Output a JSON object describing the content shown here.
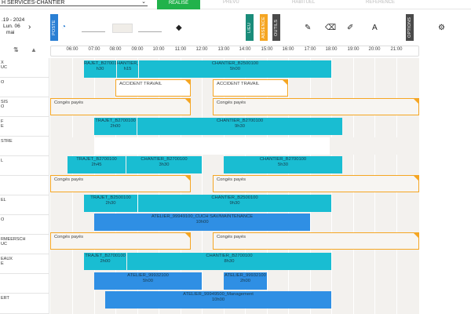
{
  "nav": {
    "filter_select": "H SERVICES-CHANTIER",
    "active_tab": "RÉALISÉ",
    "tabs": [
      "PRÉVU",
      "HABITUEL",
      "RÉFÉRENCE"
    ]
  },
  "toolbar": {
    "date_line1": ".19 - 2024",
    "date_line2": "Lun. 06",
    "date_line3": "mai",
    "vtab_poste": "POSTE",
    "vtab_lieu": "LIEU",
    "vtab_absence": "ABSENCE",
    "vtab_outils": "OUTILS",
    "vtab_options": "OPTIONS"
  },
  "hours": [
    "06:00",
    "07:00",
    "08:00",
    "09:00",
    "10:00",
    "11:00",
    "12:00",
    "13:00",
    "14:00",
    "15:00",
    "16:00",
    "17:00",
    "18:00",
    "19:00",
    "20:00",
    "21:00"
  ],
  "employees": [
    {
      "line1": "X",
      "line2": "UC"
    },
    {
      "line1": "",
      "line2": "O"
    },
    {
      "line1": "SIS",
      "line2": "O"
    },
    {
      "line1": "F",
      "line2": "E"
    },
    {
      "line1": "STRE",
      "line2": ""
    },
    {
      "line1": "",
      "line2": "L"
    },
    {
      "line1": "",
      "line2": ""
    },
    {
      "line1": "",
      "line2": "EL"
    },
    {
      "line1": "",
      "line2": "O"
    },
    {
      "line1": "RMEERSCH",
      "line2": "UC"
    },
    {
      "line1": "EAUX",
      "line2": "E"
    },
    {
      "line1": "",
      "line2": ""
    },
    {
      "line1": "ERT",
      "line2": ""
    }
  ],
  "events": [
    {
      "title": "RAJET_B2700100",
      "dur": "h30"
    },
    {
      "title": "HANTIER_B2",
      "dur": "h15"
    },
    {
      "title": "CHANTIER_B2500100",
      "dur": "5h00"
    },
    {
      "title": "ACCIDENT TRAVAIL",
      "dur": ""
    },
    {
      "title": "ACCIDENT TRAVAIL",
      "dur": ""
    },
    {
      "title": "Congés payés",
      "dur": ""
    },
    {
      "title": "Congés payés",
      "dur": ""
    },
    {
      "title": "TRAJET_B2700100",
      "dur": "2h00"
    },
    {
      "title": "CHANTIER_B2700100",
      "dur": "9h30"
    },
    {
      "title": "TRAJET_B2700100",
      "dur": "2h45"
    },
    {
      "title": "CHANTIER_B2700100",
      "dur": "3h30"
    },
    {
      "title": "CHANTIER_B2700100",
      "dur": "5h30"
    },
    {
      "title": "Congés payés",
      "dur": ""
    },
    {
      "title": "Congés payés",
      "dur": ""
    },
    {
      "title": "TRAJET_B2500100",
      "dur": "2h30"
    },
    {
      "title": "CHANTIER_B2500100",
      "dur": "9h30"
    },
    {
      "title": "ATELIER_99949100_CUCH SAV/MAINTENANCE",
      "dur": "10h00"
    },
    {
      "title": "Congés payés",
      "dur": ""
    },
    {
      "title": "Congés payés",
      "dur": ""
    },
    {
      "title": "TRAJET_B2700100",
      "dur": "2h00"
    },
    {
      "title": "CHANTIER_B2700100",
      "dur": "8h30"
    },
    {
      "title": "ATELIER_99932100",
      "dur": "5h00"
    },
    {
      "title": "ATELIER_99932100",
      "dur": "2h00"
    },
    {
      "title": "ATELIER_99949500_Management",
      "dur": "10h00"
    }
  ]
}
